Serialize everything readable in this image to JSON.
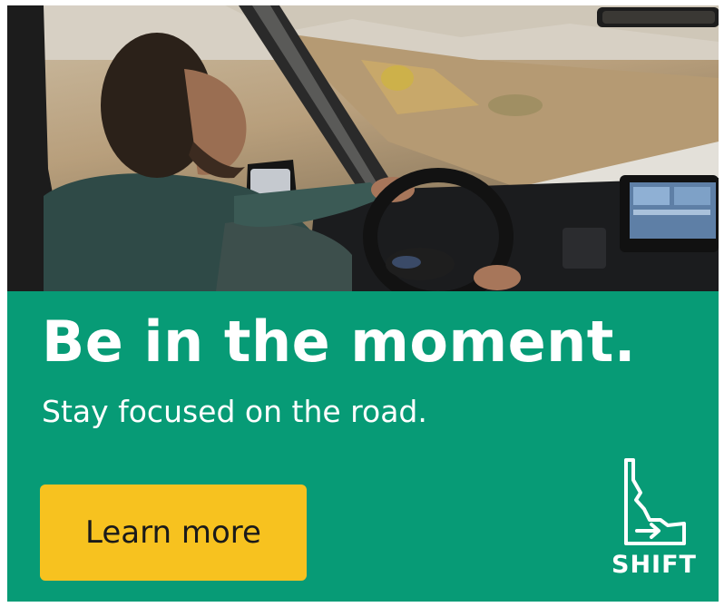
{
  "ad": {
    "headline": "Be in the moment.",
    "subline": "Stay focused on the road.",
    "cta_label": "Learn more",
    "brand": "SHIFT",
    "photo_alt": "Man driving a vehicle, hands on the steering wheel"
  },
  "colors": {
    "panel": "#079b76",
    "cta": "#f7c21f",
    "text": "#ffffff",
    "cta_text": "#1a1a1a"
  },
  "icons": [
    "idaho-state-arrow-icon"
  ]
}
